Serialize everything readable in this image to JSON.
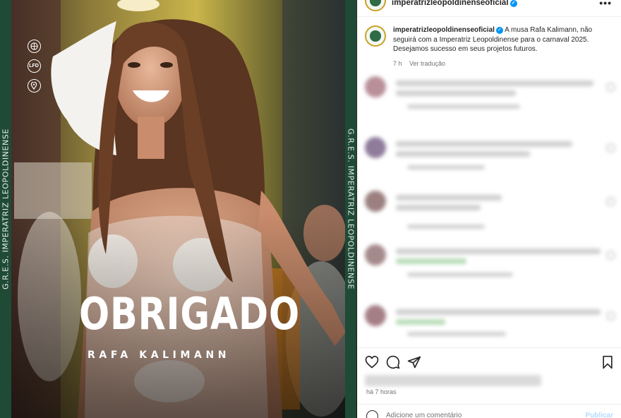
{
  "post": {
    "border_text": "G.R.E.S. IMPERATRIZ LEOPOLDINENSE",
    "headline": "OBRIGADO",
    "subline": "RAFA KALIMANN",
    "side_icons": [
      "globe-icon",
      "lfd-badge-icon",
      "location-pin-icon"
    ],
    "lfd_label": "LFD",
    "accent_color": "#1f4a36"
  },
  "header": {
    "username": "imperatrizleopoldinenseoficial",
    "more_label": "•••"
  },
  "caption": {
    "username": "imperatrizleopoldinenseoficial",
    "text": "A musa Rafa Kalimann, não seguirá com a Imperatriz Leopoldinense para o carnaval 2025. Desejamos sucesso em seus projetos futuros.",
    "age": "7 h",
    "translate": "Ver tradução"
  },
  "footer": {
    "posted_ago": "há 7 horas",
    "comment_placeholder": "Adicione um comentário",
    "publish_label": "Publicar"
  },
  "colors": {
    "verified": "#0095f6",
    "muted_text": "#737373"
  }
}
